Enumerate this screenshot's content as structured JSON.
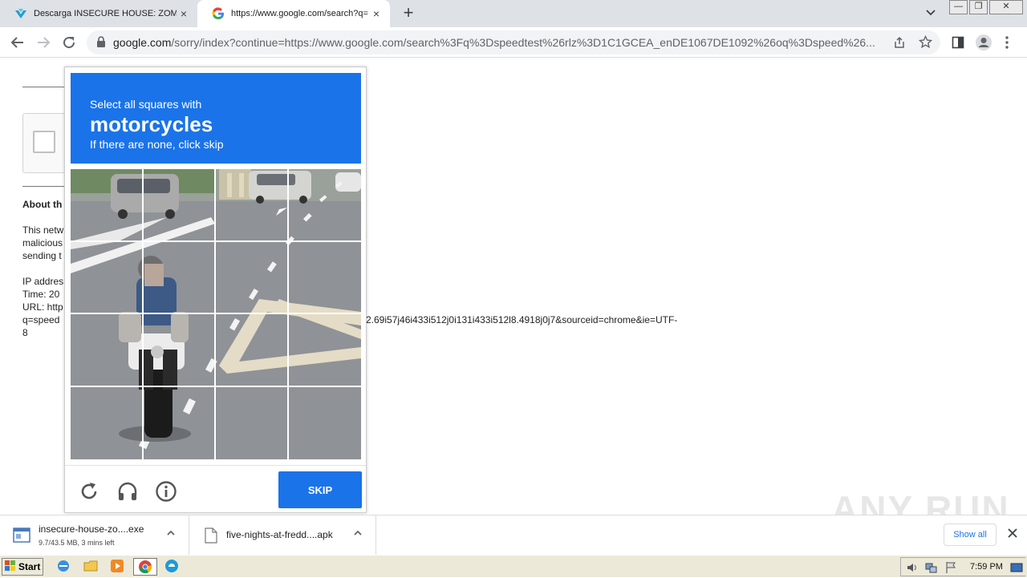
{
  "tabs": [
    {
      "title": "Descarga INSECURE HOUSE: ZOMBI",
      "close": "×"
    },
    {
      "title": "https://www.google.com/search?q=",
      "close": "×"
    }
  ],
  "new_tab": "+",
  "window_controls": {
    "minimize": "—",
    "restore": "❐",
    "close": "✕"
  },
  "omnibox": {
    "host": "google.com",
    "path": "/sorry/index?continue=https://www.google.com/search%3Fq%3Dspeedtest%26rlz%3D1C1GCEA_enDE1067DE1092%26oq%3Dspeed%26..."
  },
  "page": {
    "about_heading": "About th",
    "para_lines": [
      "This netw",
      "malicious",
      "sending t"
    ],
    "info_lines": [
      "IP addres",
      "Time: 20",
      "URL: http",
      "q=speed"
    ],
    "url_tail": "2.69i57j46i433i512j0i131i433i512l8.4918j0j7&sourceid=chrome&ie=UTF-",
    "url_end": "8"
  },
  "captcha": {
    "line1": "Select all squares with",
    "target": "motorcycles",
    "line3": "If there are none, click skip",
    "skip_label": "SKIP"
  },
  "downloads": [
    {
      "name": "insecure-house-zo....exe",
      "status": "9.7/43.5 MB, 3 mins left"
    },
    {
      "name": "five-nights-at-fredd....apk",
      "status": ""
    }
  ],
  "show_all": "Show all",
  "watermark": "ANY RUN",
  "taskbar": {
    "start": "Start",
    "clock": "7:59 PM"
  }
}
